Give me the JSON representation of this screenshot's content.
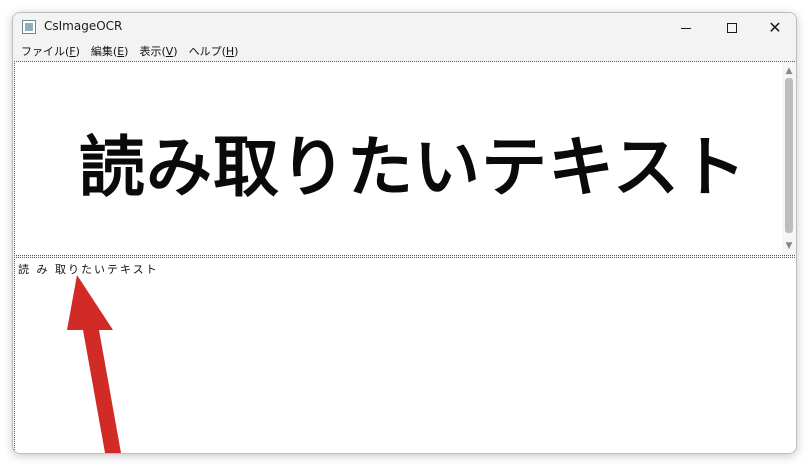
{
  "window": {
    "title": "CsImageOCR",
    "controls": {
      "minimize": "minimize",
      "maximize": "maximize",
      "close": "✕"
    }
  },
  "menu": {
    "items": [
      {
        "label": "ファイル(",
        "key": "F",
        "suffix": ")"
      },
      {
        "label": "編集(",
        "key": "E",
        "suffix": ")"
      },
      {
        "label": "表示(",
        "key": "V",
        "suffix": ")"
      },
      {
        "label": "ヘルプ(",
        "key": "H",
        "suffix": ")"
      }
    ]
  },
  "image_pane": {
    "text": "読み取りたいテキスト"
  },
  "text_pane": {
    "text": "読 み 取りたいテキスト"
  },
  "annotation": {
    "arrow_color": "#d22a27"
  }
}
